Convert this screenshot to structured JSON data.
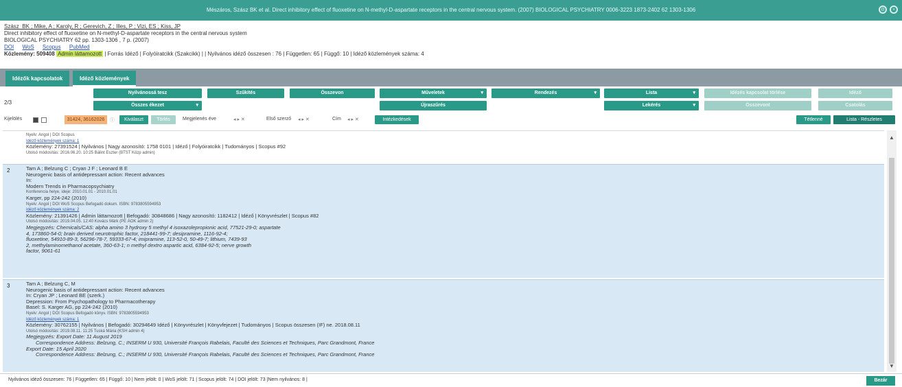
{
  "window": {
    "title": "Mészáros, Szász BK et al. Direct inhibitory effect of fluoxetine on N-methyl-D-aspartate receptors in the central nervous system. (2007) BIOLOGICAL PSYCHIATRY 0006-3223 1873-2402 62 1303-1306",
    "icons": [
      "settings-icon",
      "close-icon"
    ]
  },
  "publication": {
    "authors": "Szász_BK ; Mike, A ; Karoly, R ; Gerevich, Z ; Illes, P ; Vizi, ES ; Kiss, JP",
    "title": "Direct inhibitory effect of fluoxetine on N-methyl-D-aspartate receptors in the central nervous system",
    "journal": "BIOLOGICAL PSYCHIATRY 62 pp. 1303-1306 , 7 p. (2007)",
    "links": [
      "DOI",
      "WoS",
      "Scopus",
      "PubMed"
    ],
    "record_label": "Közlemény: 509408",
    "admin_badge": "Admin láttamozott",
    "record_meta": "| Forrás Idéző | Folyóiratcikk (Szakcikk) | | Nyilvános idéző összesen : 76 | Független: 65 | Függő: 10 | Idéző közlemények száma: 4"
  },
  "tabs": [
    {
      "label": "Idézők kapcsolatok"
    },
    {
      "label": "Idéző közlemények"
    }
  ],
  "toolbar": {
    "count": "2/3",
    "row1": [
      "Nyilvánossá tesz",
      "Szűkítés",
      "Összevon",
      "Műveletek",
      "Rendezés",
      "Lista",
      "Idézés kapcsolat törlése",
      "Idéző"
    ],
    "row2": [
      "Összes ékezet",
      "Újraszűrés",
      "Lekérés",
      "Összevont",
      "Csatolás"
    ]
  },
  "filters": {
    "label": "Kijelölés",
    "tag": "31424, 36162026",
    "button_select": "Kiválaszt",
    "button_clear": "Törlés",
    "sort1": "Megjelenés éve",
    "sort2": "Első szerző",
    "sort3": "Cím",
    "button_search": "Intézkedések",
    "right1": "Tétlenné",
    "right2": "Lista - Részletes"
  },
  "entries": [
    {
      "num": "",
      "lines": [
        "Nyelv: Angol | DOI  Scopus",
        "Idéző közlemények száma: 1",
        "Közlemény: 27391524 | Nyilvános | Nagy azonosító: 1758 0101 | Idéző | Folyóiratcikk | Tudományos | Scopus #92",
        "Utolsó módosítás: 2016.06.20. 10:25 Bálint Eszter (BTST Közp admin)"
      ]
    },
    {
      "num": "2",
      "lines": [
        "Tam A ; Belzung C ; Cryan J F ; Leonard B E",
        "Neurogenic basis of antidepressant action: Recent advances",
        "In:",
        "Modern Trends in Pharmacopsychiatry",
        "Konferencia helye, ideje: 2010.01.01 - 2010.01.01",
        "Karger, pp 224-242 (2010)",
        "Nyelv: Angol | DOI  WoS  Scopus  Befogadó dokum. ISBN: 9783805594953",
        "Idéző közlemények száma: 2",
        "Közlemény: 21391426 | Admin láttamozott | Befogadó: 30848686 | Nagy azonosító: 1182412 | Idéző | Könyvrészlet | Scopus #82",
        "Utolsó módosítás: 2019.04.05. 12:40 Kovács Márk (PE ÁOK admin 2)",
        "Megjegyzés: Chemicals/CAS: alpha amino 3 hydroxy 5 methyl 4 isoxazolepropionic acid, 77521-29-0; aspartate",
        "4, 173860-54-0; brain derived neurotrophic factor, 218441-99-7; desipramine, 1116-92-4;",
        "fluoxetine, 54910-89-3, 56296-78-7, 59333-67-4; imipramine, 113-52-0, 50-49-7; lithium, 7439-93",
        "2, methylaminomethanol acetate, 360-63-1; n methyl dextro aspartic acid, 6384-92-5; nerve growth",
        "factor, 9061-61"
      ]
    },
    {
      "num": "3",
      "lines": [
        "Tam A ; Belzung C, M",
        "Neurogenic basis of antidepressant action: Recent advances",
        "In: Cryan JP ; Leonard BE (szerk.)",
        "Depression: From Psychopathology to Pharmacotherapy",
        "Basel: S. Karger AG, pp 224-242 (2010)",
        "Nyelv: Angol | DOI  Scopus  Befogadó könyv. ISBN: 9783805594953",
        "Idéző közlemények száma: 1",
        "Közlemény: 30762155 | Nyilvános | Befogadó: 30294649 Idéző | Könyvrészlet | Könyvfejezet | Tudományos | Scopus összesen (IF) ne. 2018.08.11",
        "Utolsó módosítás: 2019.08.11. 11:25 Tuská Mária (KSH admin 4)",
        "Megjegyzés: Export Date: 11 August 2019",
        "Correspondence Address: Belzung, C.; INSERM U 930, Université François Rabelais, Faculté des Sciences et Techniques, Parc Grandmont, France",
        "Export Date: 15 April 2020",
        "Correspondence Address: Belzung, C.; INSERM U 930, Université François Rabelais, Faculté des Sciences et Techniques, Parc Grandmont, France"
      ]
    }
  ],
  "footer": {
    "summary": "Nyilvános idéző összesen: 76 | Független: 65 | Függő: 10 | Nem jelölt: 0 | WoS jelölt: 71 | Scopus jelölt: 74 | DOI jelölt: 73 |Nem nyilvános: 8 |",
    "button": "Bezár"
  }
}
